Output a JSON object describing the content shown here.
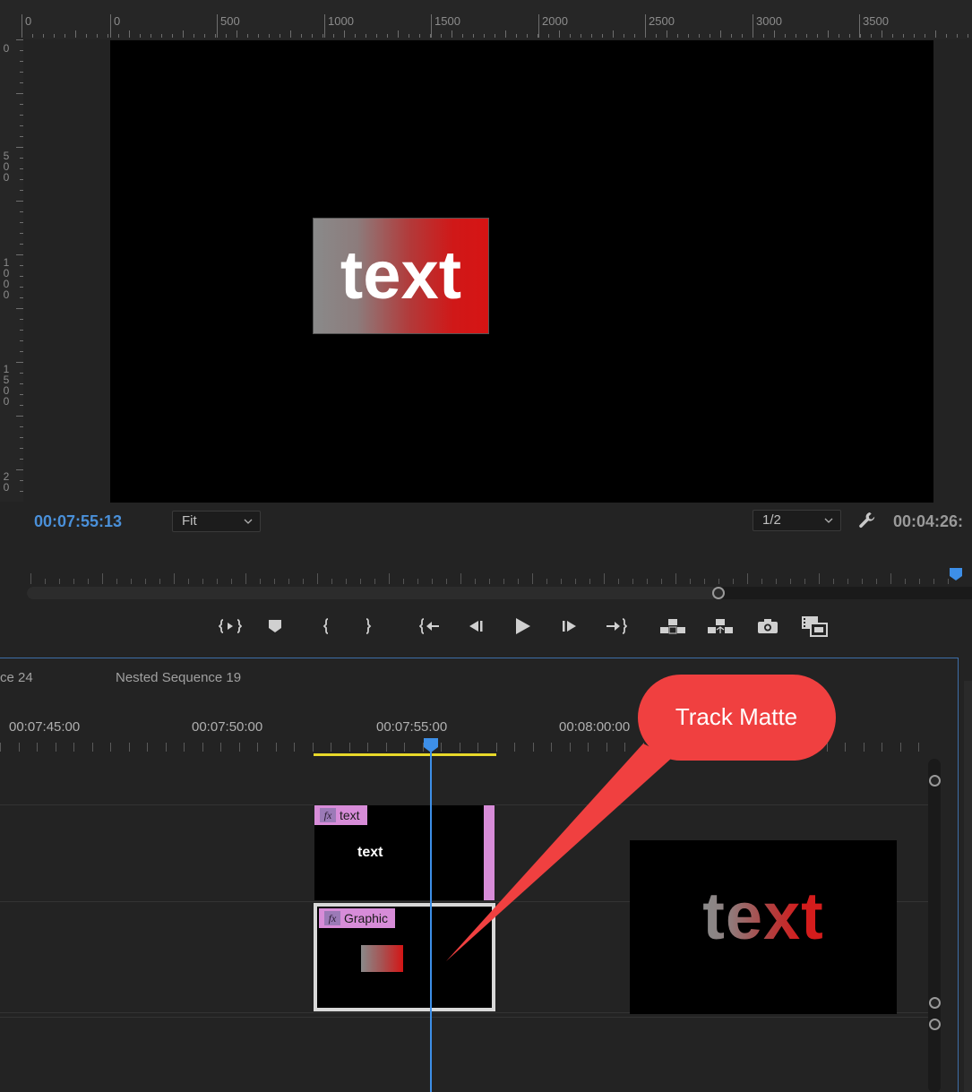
{
  "monitor": {
    "ruler_top_labels": [
      "0",
      "0",
      "500",
      "1000",
      "1500",
      "2000",
      "2500",
      "3000",
      "3500"
    ],
    "ruler_left_labels": [
      "0",
      "500",
      "1000",
      "1500",
      "20"
    ],
    "canvas_text": "text",
    "current_timecode": "00:07:55:13",
    "zoom_level": "Fit",
    "playback_resolution": "1/2",
    "duration_timecode": "00:04:26:",
    "icons": {
      "wrench": "wrench-icon",
      "transport": [
        "mark-in-out-icon",
        "add-marker-icon",
        "mark-in-icon",
        "mark-out-icon",
        "go-to-in-icon",
        "step-back-icon",
        "play-icon",
        "step-forward-icon",
        "go-to-out-icon",
        "lift-icon",
        "extract-icon",
        "export-frame-icon",
        "comparison-view-icon"
      ]
    }
  },
  "timeline": {
    "tabs": [
      "ce 24",
      "Nested Sequence 19"
    ],
    "ruler_timecodes": [
      "00:07:45:00",
      "00:07:50:00",
      "00:07:55:00",
      "00:08:00:00"
    ],
    "clips": [
      {
        "label": "text",
        "fx": "fx",
        "content": "text",
        "color": "#d78cd8"
      },
      {
        "label": "Graphic",
        "fx": "fx",
        "color": "#d78cd8"
      }
    ],
    "preview_text": "text"
  },
  "annotation": {
    "callout_text": "Track Matte",
    "callout_color": "#f04040"
  },
  "colors": {
    "accent_timecode": "#4a90d9",
    "playhead": "#3d8fe8",
    "work_area": "#e8d82a",
    "clip_label": "#d78cd8"
  }
}
